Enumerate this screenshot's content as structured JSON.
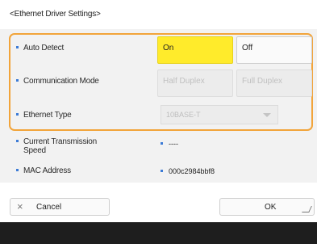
{
  "header": {
    "title": "<Ethernet Driver Settings>"
  },
  "settings": {
    "auto_detect": {
      "label": "Auto Detect",
      "on": "On",
      "off": "Off",
      "selected": "On"
    },
    "communication_mode": {
      "label": "Communication Mode",
      "half": "Half Duplex",
      "full": "Full Duplex"
    },
    "ethernet_type": {
      "label": "Ethernet Type",
      "value": "10BASE-T"
    }
  },
  "info": {
    "speed": {
      "label_line1": "Current Transmission",
      "label_line2": "Speed",
      "value": "----"
    },
    "mac": {
      "label": "MAC Address",
      "value": "000c2984bbf8"
    }
  },
  "footer": {
    "cancel_label": "Cancel",
    "ok_label": "OK"
  },
  "colors": {
    "accent_border": "#f2a43a",
    "selected": "#ffeb2b",
    "bullet": "#3c7bd6"
  }
}
